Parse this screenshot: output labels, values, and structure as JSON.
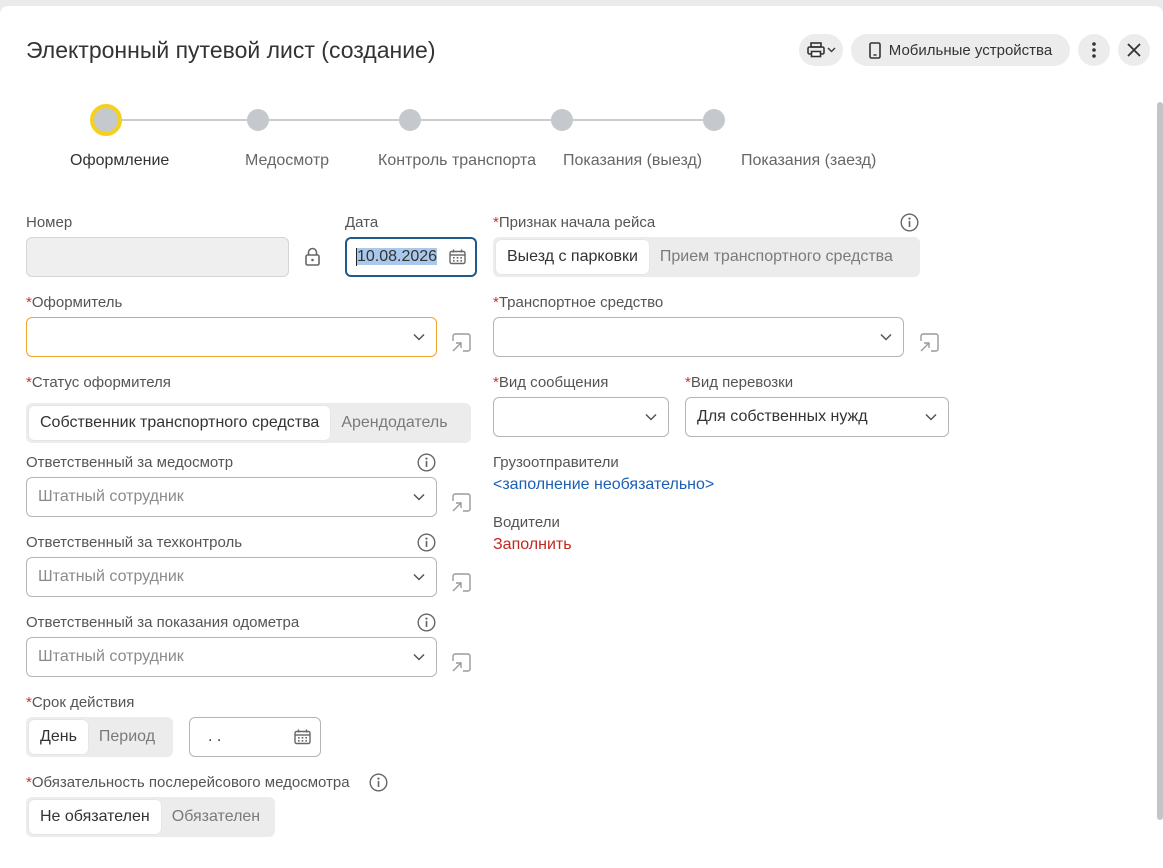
{
  "title": "Электронный путевой лист (создание)",
  "header": {
    "mobile_label": "Мобильные устройства"
  },
  "steps": [
    {
      "label": "Оформление",
      "active": true
    },
    {
      "label": "Медосмотр"
    },
    {
      "label": "Контроль транспорта"
    },
    {
      "label": "Показания (выезд)"
    },
    {
      "label": "Показания (заезд)"
    }
  ],
  "form": {
    "number": {
      "label": "Номер",
      "value": ""
    },
    "date": {
      "label": "Дата",
      "value": "10.08.2026"
    },
    "trip_start": {
      "label": "Признак начала рейса",
      "options": [
        "Выезд с парковки",
        "Прием транспортного средства"
      ],
      "selected": "Выезд с парковки"
    },
    "issuer": {
      "label": "Оформитель",
      "value": ""
    },
    "vehicle": {
      "label": "Транспортное средство",
      "value": ""
    },
    "issuer_status": {
      "label": "Статус оформителя",
      "options": [
        "Собственник транспортного средства",
        "Арендодатель"
      ],
      "selected": "Собственник транспортного средства"
    },
    "message_type": {
      "label": "Вид сообщения",
      "value": ""
    },
    "transport_type": {
      "label": "Вид перевозки",
      "value": "Для собственных нужд"
    },
    "resp_medical": {
      "label": "Ответственный за медосмотр",
      "placeholder": "Штатный сотрудник"
    },
    "resp_tech": {
      "label": "Ответственный за техконтроль",
      "placeholder": "Штатный сотрудник"
    },
    "resp_odometer": {
      "label": "Ответственный за показания одометра",
      "placeholder": "Штатный сотрудник"
    },
    "shippers": {
      "label": "Грузоотправители",
      "link": "<заполнение необязательно>"
    },
    "drivers": {
      "label": "Водители",
      "link": "Заполнить"
    },
    "validity": {
      "label": "Срок действия",
      "options": [
        "День",
        "Период"
      ],
      "selected": "День",
      "date_value": ". ."
    },
    "post_trip_medical": {
      "label": "Обязательность послерейсового медосмотра",
      "options": [
        "Не обязателен",
        "Обязателен"
      ],
      "selected": "Не обязателен"
    }
  },
  "colors": {
    "accent_yellow": "#f5d11c",
    "link_blue": "#1a5fb4",
    "link_red": "#c0281f",
    "required_red": "#d0302f",
    "focus_blue": "#1e5a8c",
    "warning_orange": "#f0a429"
  }
}
